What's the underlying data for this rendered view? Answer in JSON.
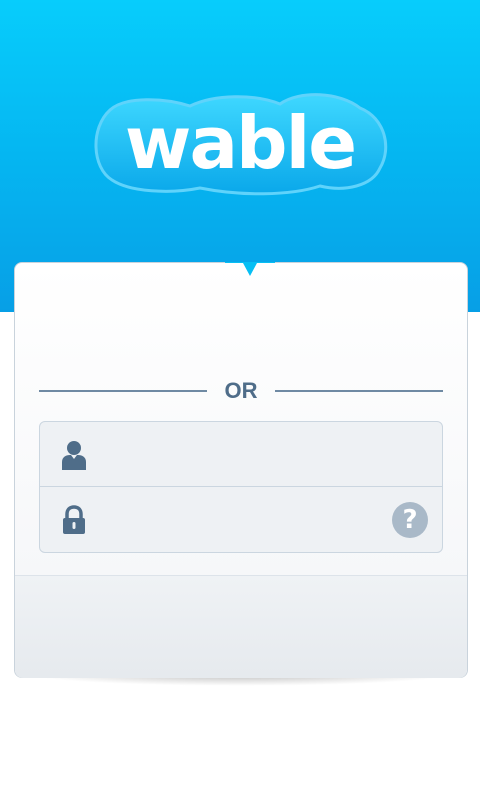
{
  "brand": {
    "logo_text": "wable",
    "colors": {
      "header_top": "#07cdfc",
      "header_bottom": "#079fe6",
      "logo_fill": "#ffffff",
      "logo_outline": "#5fd3fb",
      "divider": "#6f8aa3",
      "label": "#4f6d89",
      "icon": "#4f6d89",
      "help": "#a9b9c8"
    }
  },
  "login": {
    "divider_text": "OR",
    "username": {
      "icon": "user-icon",
      "value": "",
      "placeholder": ""
    },
    "password": {
      "icon": "lock-icon",
      "value": "",
      "placeholder": ""
    },
    "help": {
      "icon": "question-icon",
      "glyph": "?"
    }
  }
}
